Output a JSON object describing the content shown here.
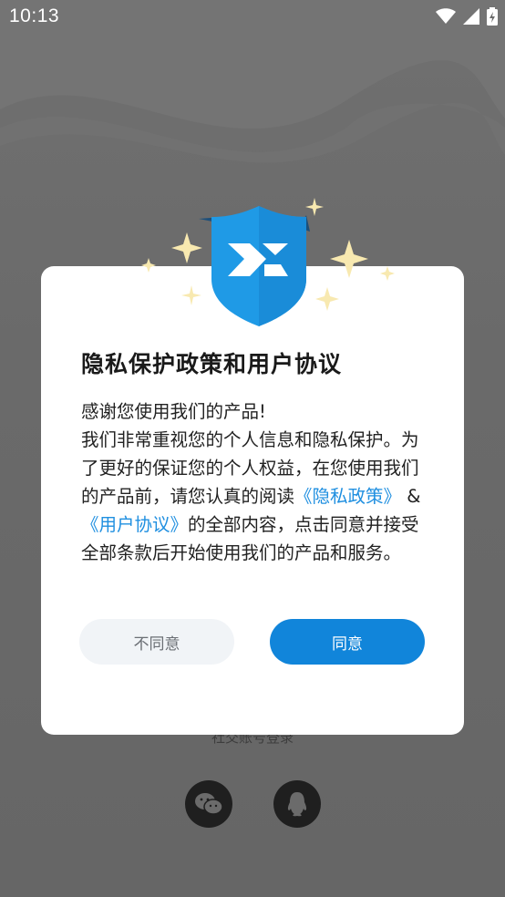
{
  "status_bar": {
    "time": "10:13",
    "icons": [
      "wifi-icon",
      "signal-icon",
      "battery-charging-icon"
    ]
  },
  "background": {
    "social_login_caption": "社交账号登录",
    "social_buttons": [
      {
        "name": "wechat",
        "icon": "wechat-icon"
      },
      {
        "name": "qq",
        "icon": "qq-icon"
      }
    ]
  },
  "dialog": {
    "title": "隐私保护政策和用户协议",
    "body": {
      "line1": "感谢您使用我们的产品!",
      "line2": "我们非常重视您的个人信息和隐私保护。为了更好的保证您的个人权益，在您使用我们的产品前，请您认真的阅读",
      "privacy_link": "《隐私政策》",
      "amp": " & ",
      "terms_link": "《用户协议》",
      "line3": "的全部内容，点击同意并接受全部条款后开始使用我们的产品和服务。"
    },
    "decline_label": "不同意",
    "agree_label": "同意"
  },
  "colors": {
    "accent": "#1185da",
    "link": "#1f8fe0",
    "shield": "#1f9ae6",
    "sparkle": "#f8e9b0"
  }
}
